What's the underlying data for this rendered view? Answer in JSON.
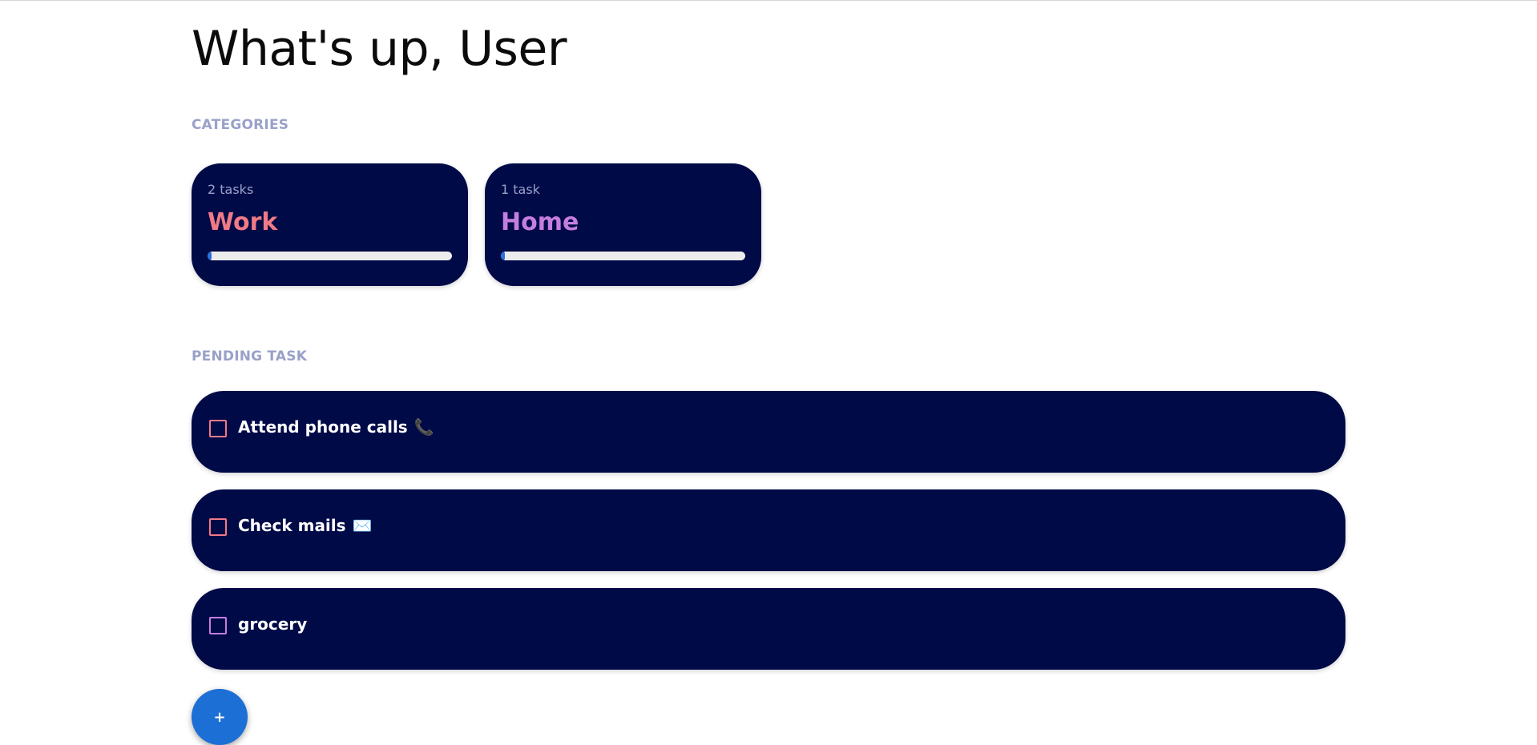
{
  "header": {
    "title": "What's up, User"
  },
  "categories": {
    "label": "CATEGORIES",
    "items": [
      {
        "count_label": "2 tasks",
        "name": "Work",
        "color": "#f07a86",
        "progress": 0.015
      },
      {
        "count_label": "1 task",
        "name": "Home",
        "color": "#c47ee0",
        "progress": 0.01
      }
    ]
  },
  "pending": {
    "label": "PENDING TASK",
    "tasks": [
      {
        "text": "Attend phone calls",
        "emoji": "📞",
        "emoji_icon": "phone-icon",
        "checkbox_color": "#f07a86",
        "checked": false
      },
      {
        "text": "Check mails",
        "emoji": "✉️",
        "emoji_icon": "envelope-icon",
        "checkbox_color": "#f07a86",
        "checked": false
      },
      {
        "text": "grocery",
        "emoji": "",
        "emoji_icon": "",
        "checkbox_color": "#c47ee0",
        "checked": false
      }
    ]
  },
  "fab": {
    "label": "+",
    "color": "#1c6fd4"
  },
  "colors": {
    "card_background": "#000a47",
    "section_label": "#9aa1c9",
    "progress_fill": "#2a6fe0",
    "progress_track": "#ececec"
  }
}
